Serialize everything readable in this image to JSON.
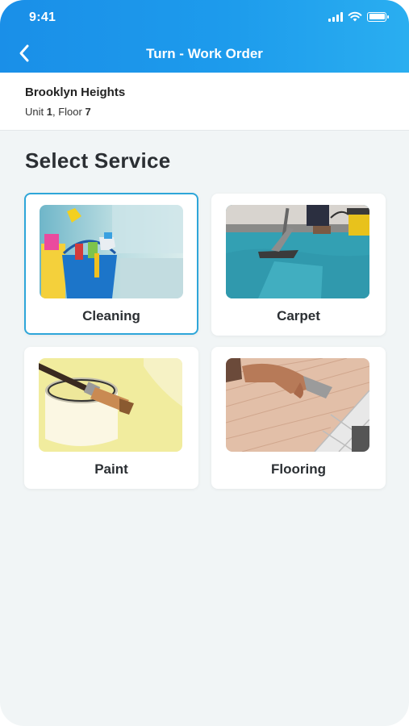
{
  "status_bar": {
    "time": "9:41"
  },
  "nav": {
    "title": "Turn - Work Order"
  },
  "location": {
    "property": "Brooklyn Heights",
    "unit_label": "Unit",
    "unit_value": "1",
    "floor_label": ", Floor",
    "floor_value": "7"
  },
  "section_title": "Select Service",
  "services": [
    {
      "label": "Cleaning",
      "selected": true
    },
    {
      "label": "Carpet",
      "selected": false
    },
    {
      "label": "Paint",
      "selected": false
    },
    {
      "label": "Flooring",
      "selected": false
    }
  ],
  "colors": {
    "header_gradient_start": "#1a8fe8",
    "header_gradient_end": "#2aaef0",
    "selected_border": "#2ea6d9",
    "background": "#f1f5f6"
  },
  "icons": [
    "back-chevron-icon",
    "signal-icon",
    "wifi-icon",
    "battery-icon"
  ]
}
